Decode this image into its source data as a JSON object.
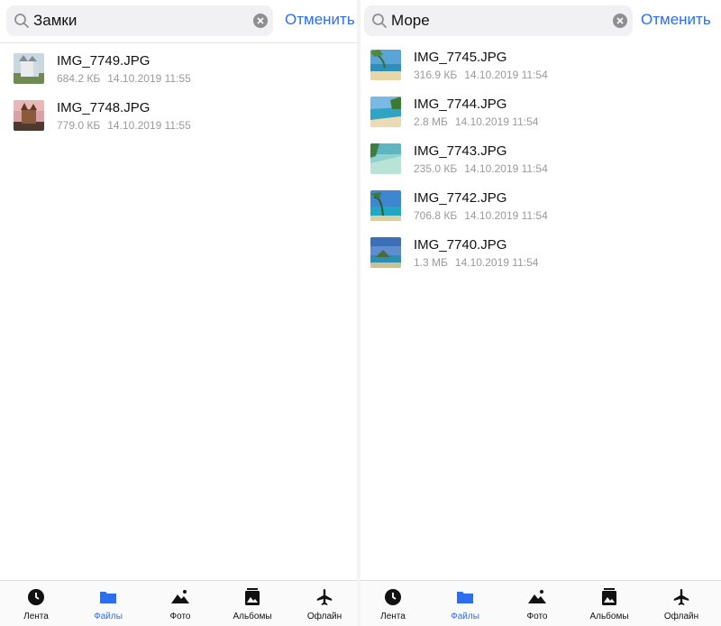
{
  "left": {
    "search": {
      "value": "Замки",
      "cancel_label": "Отменить"
    },
    "files": [
      {
        "name": "IMG_7749.JPG",
        "size": "684.2 КБ",
        "date": "14.10.2019 11:55"
      },
      {
        "name": "IMG_7748.JPG",
        "size": "779.0 КБ",
        "date": "14.10.2019 11:55"
      }
    ]
  },
  "right": {
    "search": {
      "value": "Море",
      "cancel_label": "Отменить"
    },
    "files": [
      {
        "name": "IMG_7745.JPG",
        "size": "316.9 КБ",
        "date": "14.10.2019 11:54"
      },
      {
        "name": "IMG_7744.JPG",
        "size": "2.8 МБ",
        "date": "14.10.2019 11:54"
      },
      {
        "name": "IMG_7743.JPG",
        "size": "235.0 КБ",
        "date": "14.10.2019 11:54"
      },
      {
        "name": "IMG_7742.JPG",
        "size": "706.8 КБ",
        "date": "14.10.2019 11:54"
      },
      {
        "name": "IMG_7740.JPG",
        "size": "1.3 МБ",
        "date": "14.10.2019 11:54"
      }
    ]
  },
  "tabs": [
    {
      "label": "Лента",
      "icon": "clock-icon"
    },
    {
      "label": "Файлы",
      "icon": "folder-icon",
      "active": true
    },
    {
      "label": "Фото",
      "icon": "photo-icon"
    },
    {
      "label": "Альбомы",
      "icon": "album-icon"
    },
    {
      "label": "Офлайн",
      "icon": "airplane-icon"
    }
  ],
  "colors": {
    "accent": "#2d6ef0",
    "meta": "#9a9a9a",
    "icon": "#111111"
  }
}
